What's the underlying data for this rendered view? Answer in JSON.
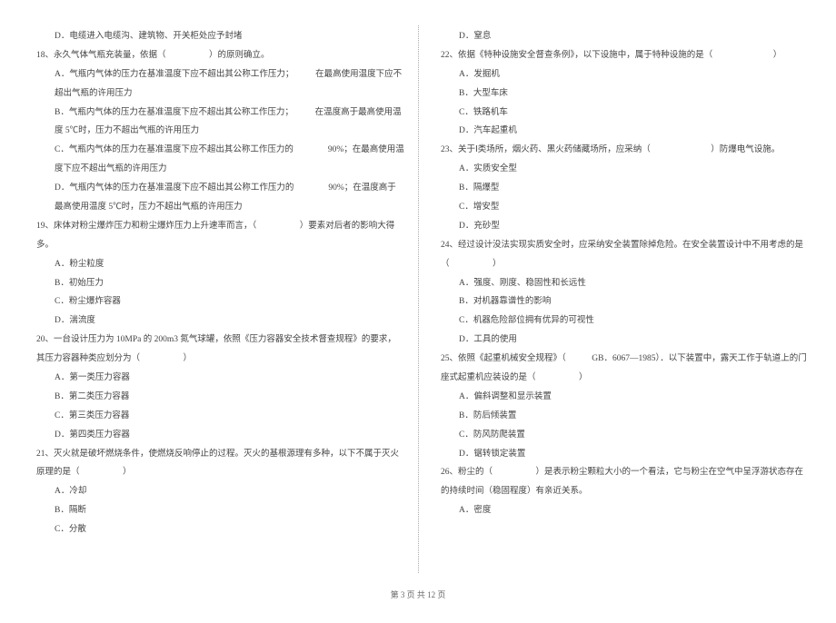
{
  "left": {
    "l00": "D．电缆进入电缆沟、建筑物、开关柜处应予封堵",
    "l01": "18、永久气体气瓶充装量，依据（　　　　　）的原则确立。",
    "l02": "A．气瓶内气体的压力在基准温度下应不超出其公称工作压力；　　　在最高使用温度下应不超出气瓶的许用压力",
    "l04": "B．气瓶内气体的压力在基准温度下应不超出其公称工作压力；　　　在温度高于最高使用温度 5℃时，压力不超出气瓶的许用压力",
    "l06": "C．气瓶内气体的压力在基准温度下应不超出其公称工作压力的　　　　90%；在最高使用温度下应不超出气瓶的许用压力",
    "l08": "D．气瓶内气体的压力在基准温度下应不超出其公称工作压力的　　　　90%；在温度高于最高使用温度 5℃时，压力不超出气瓶的许用压力",
    "l10": "19、床体对粉尘爆炸压力和粉尘爆炸压力上升速率而言，（　　　　　）要素对后者的影响大得多。",
    "l11": "A．粉尘粒度",
    "l12": "B．初始压力",
    "l13": "C．粉尘爆炸容器",
    "l14": "D．湍流度",
    "l15": "20、一台设计压力为 10MPa 的 200m3 氮气球罐，依照《压力容器安全技术督查规程》的要求，其压力容器种类应划分为（　　　　　）",
    "l17": "A．第一类压力容器",
    "l18": "B．第二类压力容器",
    "l19": "C．第三类压力容器",
    "l20": "D．第四类压力容器",
    "l21": "21、灭火就是破坏燃烧条件，使燃烧反响停止的过程。灭火的基根源理有多种，以下不属于灭火原理的是（　　　　　）",
    "l23": "A．冷却",
    "l24": "B．隔断",
    "l25": "C．分散"
  },
  "right": {
    "r00": "D．窒息",
    "r01": "22、依据《特种设施安全督查条例》，以下设施中，属于特种设施的是（　　　　　　　）",
    "r02": "A．发掘机",
    "r03": "B．大型车床",
    "r04": "C．铁路机车",
    "r05": "D．汽车起重机",
    "r06": "23、关于Ⅰ类场所，烟火药、黑火药储藏场所，应采纳（　　　　　　　）防爆电气设施。",
    "r07": "A．实质安全型",
    "r08": "B．隔爆型",
    "r09": "C．增安型",
    "r10": "D．充砂型",
    "r11": "24、经过设计没法实现实质安全时，应采纳安全装置除掉危险。在安全装置设计中不用考虑的是（　　　　　）",
    "r13": "A．强度、刚度、稳固性和长远性",
    "r14": "B．对机器靠谱性的影响",
    "r15": "C．机器危险部位拥有优异的可视性",
    "r16": "D．工具的使用",
    "r17": "25、依照《起重机械安全规程》（　　　GB．6067—1985）．以下装置中，露天工作于轨道上的门座式起重机应装设的是（　　　　　）",
    "r19": "A．偏斜调整和显示装置",
    "r20": "B．防后倾装置",
    "r21": "C．防风防爬装置",
    "r22": "D．锯转锁定装置",
    "r23": "26、粉尘的（　　　　　）是表示粉尘颗粒大小的一个看法，它与粉尘在空气中呈浮游状态存在的持续时间（稳固程度）有亲近关系。",
    "r25": "A．密度"
  },
  "footer": "第 3 页 共 12 页"
}
